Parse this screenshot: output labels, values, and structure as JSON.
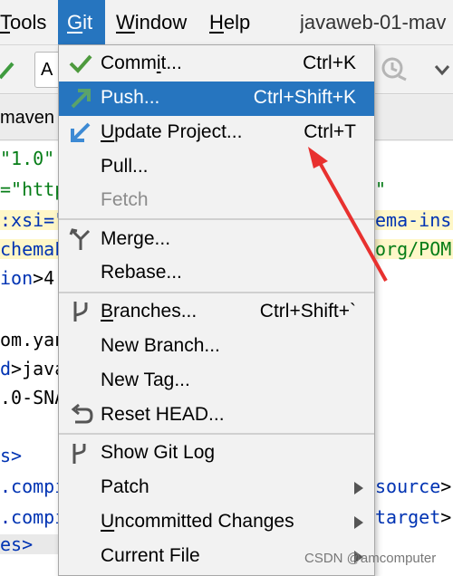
{
  "menubar": {
    "items": [
      {
        "label": "Tools",
        "mnemonic": "T"
      },
      {
        "label": "Git",
        "mnemonic": "G"
      },
      {
        "label": "Window",
        "mnemonic": "W"
      },
      {
        "label": "Help",
        "mnemonic": "H"
      }
    ],
    "window_title": "javaweb-01-mav"
  },
  "toolbar": {
    "config_box_text": "A"
  },
  "editor": {
    "tab_label": "maven",
    "lines": {
      "l1": "\"1.0\"",
      "l2": "=\"http",
      "l2r": "\"",
      "l3": ":xsi=\"",
      "l3r": "ema-ins",
      "l4": "chemaL",
      "l4r": "org/POM",
      "l5a": "ion",
      "l5b": ">4.",
      "l6": "om.yan",
      "l7a": "d",
      "l7b": ">java",
      "l8": ".0-SNA",
      "l9": "s>",
      "l10": ".compi",
      "l10r1": "source",
      "l10r2": ">",
      "l11": ".compi",
      "l11r1": "target",
      "l11r2": ">",
      "l12": "es>"
    }
  },
  "menu": {
    "items": [
      {
        "label": "Commit...",
        "mnemonic_index": 4,
        "shortcut": "Ctrl+K",
        "icon": "check-icon"
      },
      {
        "label": "Push...",
        "shortcut": "Ctrl+Shift+K",
        "icon": "push-arrow-icon",
        "selected": true
      },
      {
        "label": "Update Project...",
        "mnemonic_index": 0,
        "shortcut": "Ctrl+T",
        "icon": "update-arrow-icon"
      },
      {
        "label": "Pull...",
        "shortcut": ""
      },
      {
        "label": "Fetch",
        "shortcut": "",
        "disabled": true
      },
      {
        "label": "Merge...",
        "shortcut": "",
        "icon": "merge-icon"
      },
      {
        "label": "Rebase...",
        "shortcut": ""
      },
      {
        "label": "Branches...",
        "mnemonic_index": 0,
        "shortcut": "Ctrl+Shift+`",
        "icon": "branch-icon"
      },
      {
        "label": "New Branch...",
        "shortcut": ""
      },
      {
        "label": "New Tag...",
        "shortcut": ""
      },
      {
        "label": "Reset HEAD...",
        "shortcut": "",
        "icon": "reset-icon"
      },
      {
        "label": "Show Git Log",
        "shortcut": "",
        "icon": "git-log-icon"
      },
      {
        "label": "Patch",
        "shortcut": "",
        "submenu": true
      },
      {
        "label": "Uncommitted Changes",
        "mnemonic_index": 0,
        "shortcut": "",
        "submenu": true
      },
      {
        "label": "Current File",
        "shortcut": "",
        "submenu": true
      }
    ]
  },
  "watermark": "CSDN @amcomputer",
  "colors": {
    "selection": "#2675bf",
    "menu_bg": "#f2f2f2",
    "check_green": "#4e9a3e",
    "push_green": "#5aa36a",
    "update_blue": "#3d8ad4",
    "annotation_red": "#e8312f"
  }
}
